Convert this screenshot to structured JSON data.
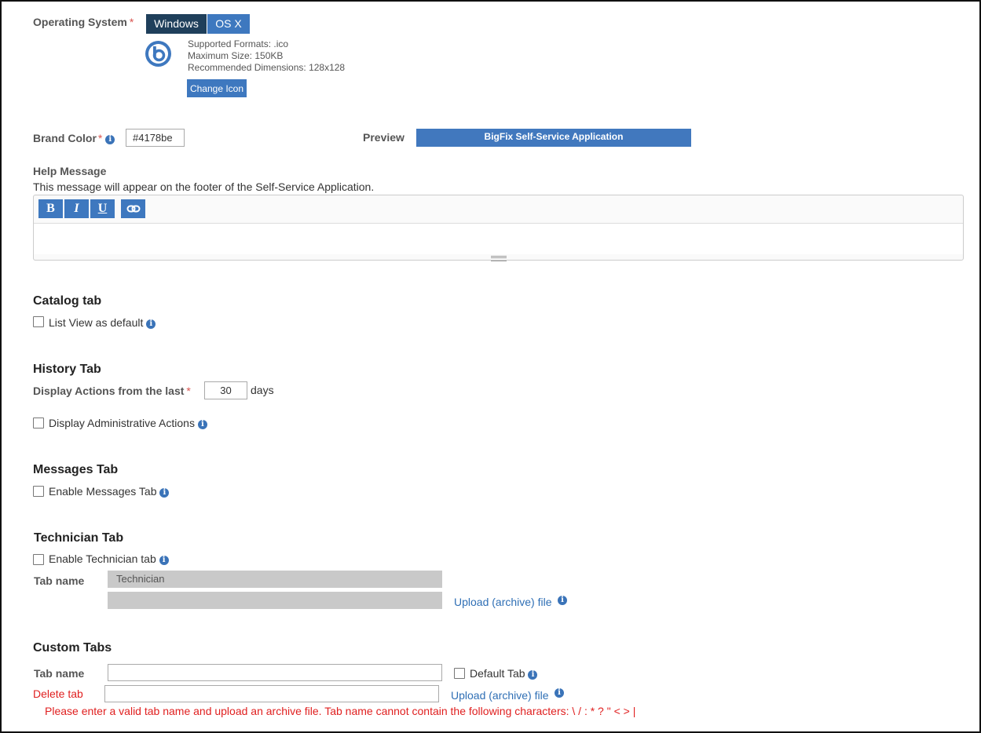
{
  "os": {
    "label": "Operating System",
    "required": "*",
    "options": [
      "Windows",
      "OS X"
    ],
    "selected": "Windows",
    "icon": "bigfix-logo-icon",
    "formats": "Supported Formats: .ico",
    "max_size": "Maximum Size: 150KB",
    "dimensions": "Recommended Dimensions: 128x128",
    "change_icon": "Change Icon"
  },
  "brand": {
    "label": "Brand Color",
    "required": "*",
    "value": "#4178be",
    "preview_label": "Preview",
    "preview_text": "BigFix Self-Service Application"
  },
  "help": {
    "title": "Help Message",
    "description": "This message will appear on the footer of the Self-Service Application.",
    "toolbar": {
      "bold": "B",
      "italic": "I",
      "underline": "U",
      "link": "link-icon"
    },
    "value": ""
  },
  "catalog": {
    "title": "Catalog tab",
    "list_view": "List View as default"
  },
  "history": {
    "title": "History Tab",
    "actions_label": "Display Actions from the last",
    "required": "*",
    "days_value": "30",
    "days_unit": "days",
    "admin_actions": "Display Administrative Actions"
  },
  "messages": {
    "title": "Messages Tab",
    "enable": "Enable Messages Tab"
  },
  "technician": {
    "title": "Technician Tab",
    "enable": "Enable Technician tab",
    "tab_name_label": "Tab name",
    "tab_name_value": "Technician",
    "upload": "Upload (archive) file"
  },
  "custom": {
    "title": "Custom Tabs",
    "tab_name_label": "Tab name",
    "tab_name_value": "",
    "default_tab": "Default Tab",
    "delete": "Delete tab",
    "upload": "Upload (archive) file",
    "error": "Please enter a valid tab name and upload an archive file. Tab name cannot contain the following characters: \\ / : * ? \" < > |"
  },
  "colors": {
    "accent": "#3e78bf",
    "dark_segment": "#1f3f5b",
    "error": "#e02020"
  }
}
